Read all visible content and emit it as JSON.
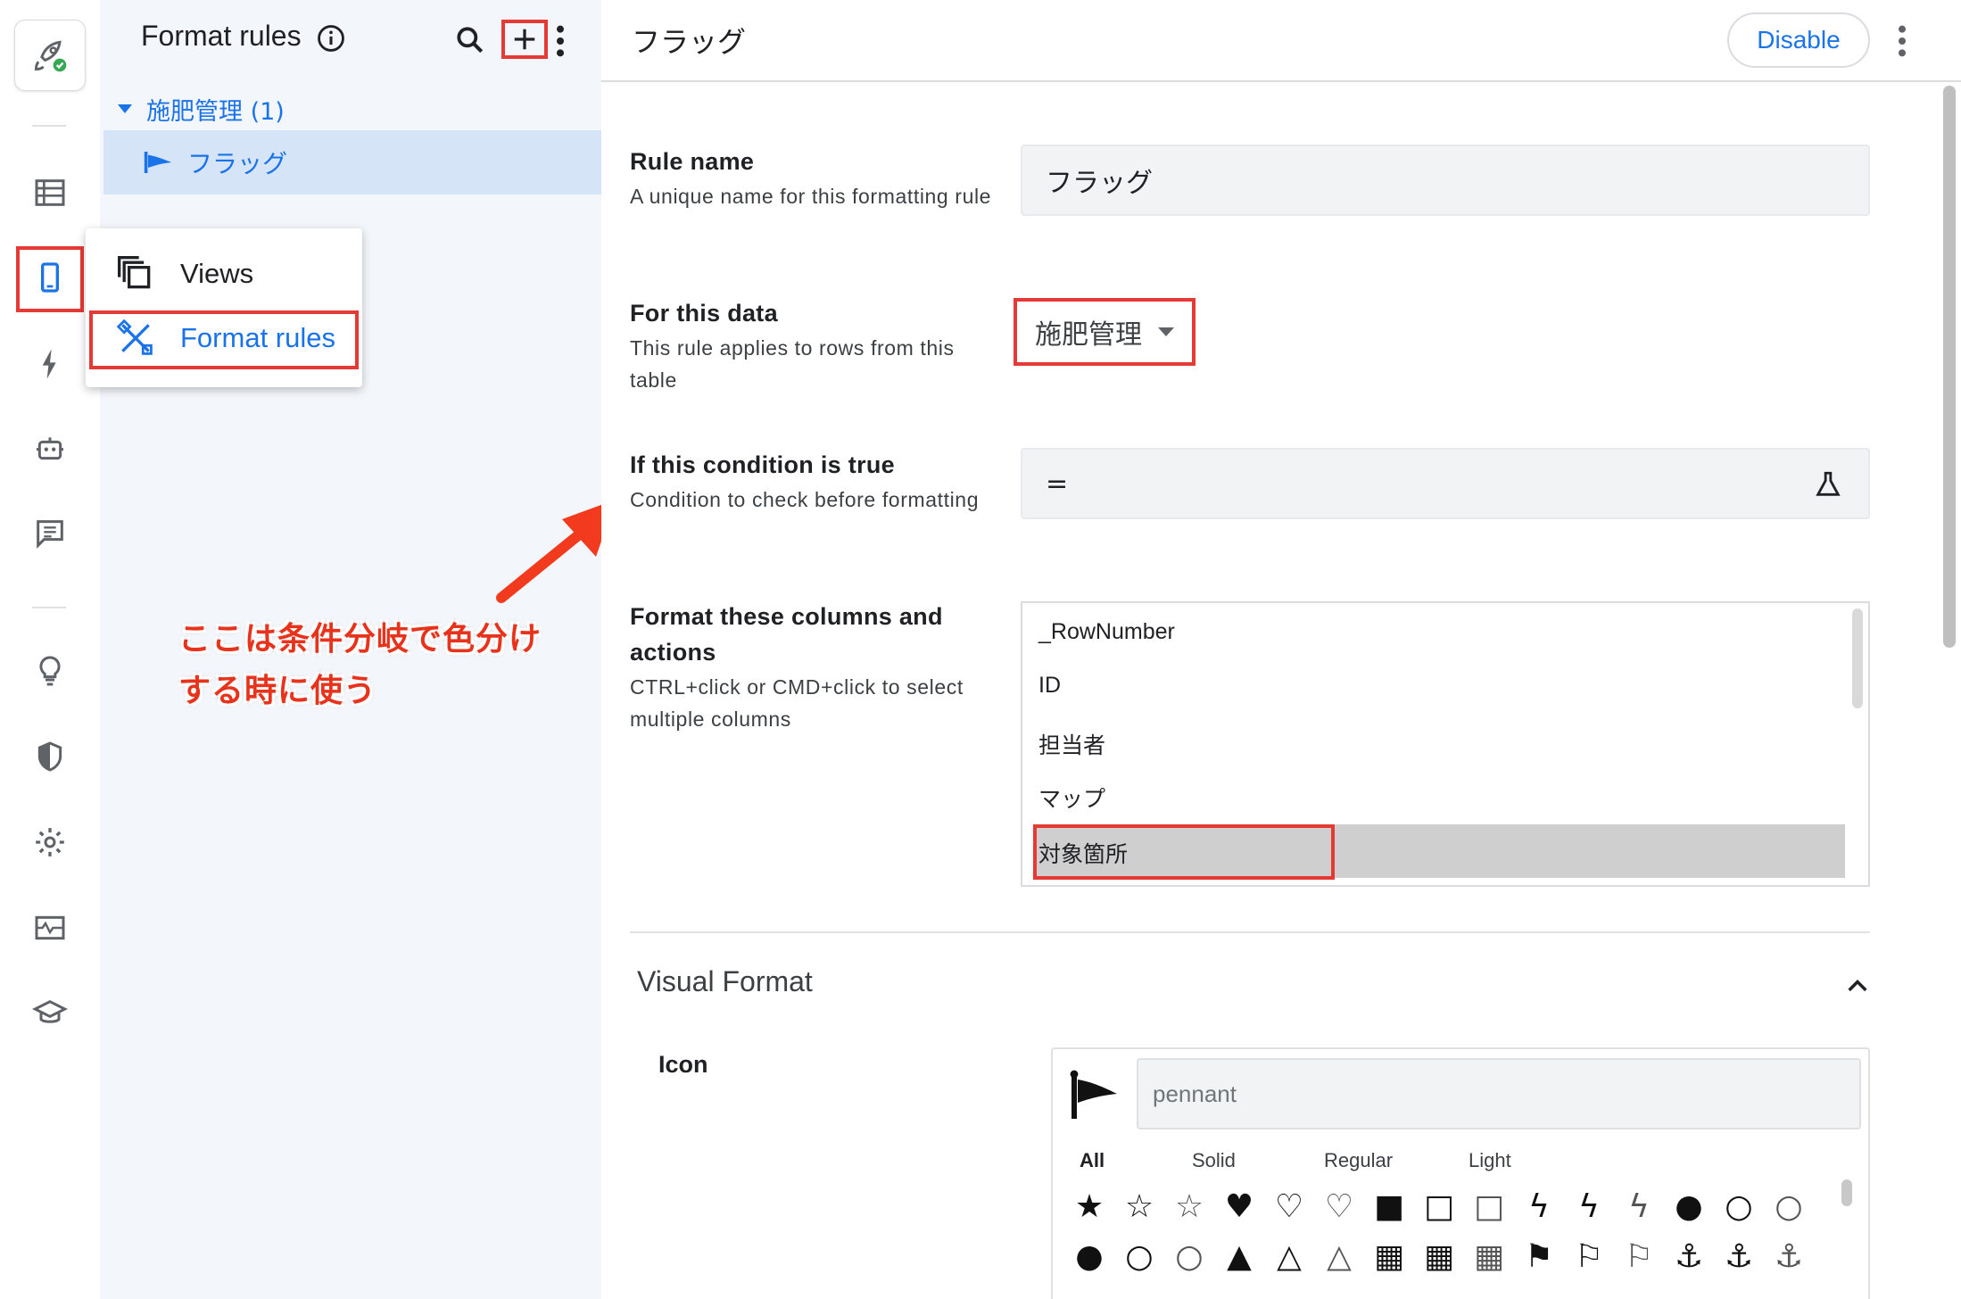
{
  "rail": {
    "icons": [
      "rocket-icon",
      "table-icon",
      "phone-view-icon",
      "bolt-icon",
      "robot-icon",
      "chat-icon",
      "lightbulb-icon",
      "shield-icon",
      "gear-icon",
      "monitor-icon",
      "graduation-cap-icon"
    ]
  },
  "rules_panel": {
    "title": "Format rules",
    "group_label": "施肥管理 (1)",
    "rule_label": "フラッグ"
  },
  "menu": {
    "views_label": "Views",
    "format_rules_label": "Format rules"
  },
  "annotation": {
    "line1": "ここは条件分岐で色分け",
    "line2": "する時に使う"
  },
  "detail": {
    "title": "フラッグ",
    "disable_label": "Disable",
    "rule_name": {
      "label": "Rule name",
      "help": "A unique name for this formatting rule",
      "value": "フラッグ"
    },
    "for_this_data": {
      "label": "For this data",
      "help": "This rule applies to rows from this table",
      "value": "施肥管理"
    },
    "condition": {
      "label": "If this condition is true",
      "help": "Condition to check before formatting",
      "value": "="
    },
    "columns": {
      "label_line1": "Format these columns and",
      "label_line2": "actions",
      "help": "CTRL+click or CMD+click to select multiple columns",
      "items": [
        "_RowNumber",
        "ID",
        "担当者",
        "マップ",
        "対象箇所"
      ],
      "selected": "対象箇所"
    },
    "visual_format": {
      "title": "Visual Format",
      "icon_label": "Icon",
      "icon_search_value": "pennant",
      "tabs": [
        "All",
        "Solid",
        "Regular",
        "Light"
      ],
      "active_tab": "All"
    }
  },
  "colors": {
    "accent": "#1a73e8",
    "highlight_red": "#e53935",
    "annotation_red": "#e8331c",
    "panel_bg": "#f3f6fb",
    "selected_row": "#d6e4f8"
  }
}
